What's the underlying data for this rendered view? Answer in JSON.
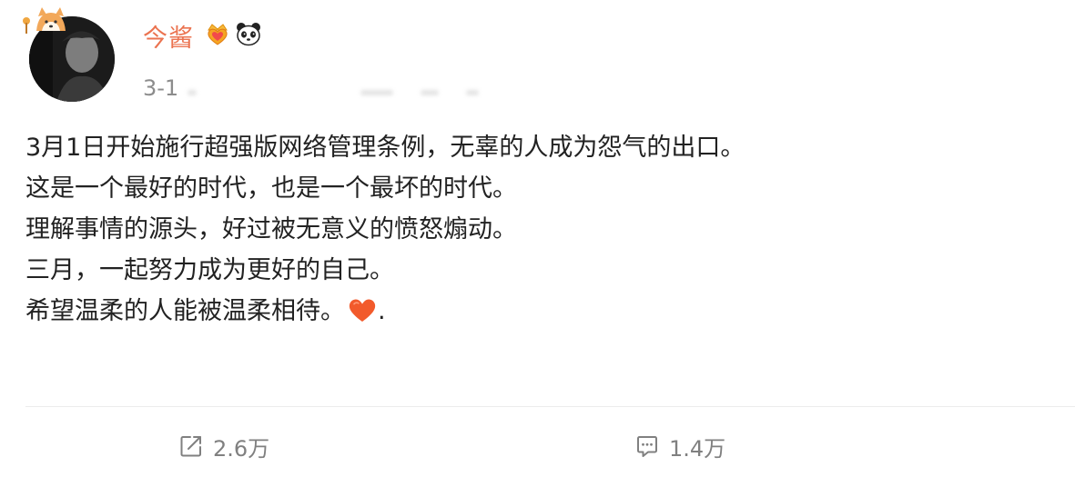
{
  "post": {
    "author": {
      "name": "今酱",
      "avatar": "avatar",
      "badges": [
        "crown-heart-badge-icon",
        "panda-badge-icon"
      ],
      "pendant": "shiba-dog-pendant-icon"
    },
    "timestamp": "3-1",
    "lines": [
      "3月1日开始施行超强版网络管理条例，无辜的人成为怨气的出口。",
      "这是一个最好的时代，也是一个最坏的时代。",
      "理解事情的源头，好过被无意义的愤怒煽动。",
      "三月，一起努力成为更好的自己。",
      "希望温柔的人能被温柔相待。"
    ],
    "last_line_suffix": ".",
    "emoji": "heart-icon"
  },
  "actions": {
    "repost": {
      "icon": "repost-icon",
      "count": "2.6万"
    },
    "comment": {
      "icon": "comment-icon",
      "count": "1.4万"
    }
  },
  "colors": {
    "username": "#eb7350",
    "text": "#222222",
    "meta": "#8c8c8c",
    "action": "#808080",
    "heart": "#f25a2b",
    "divider": "#ececec"
  }
}
